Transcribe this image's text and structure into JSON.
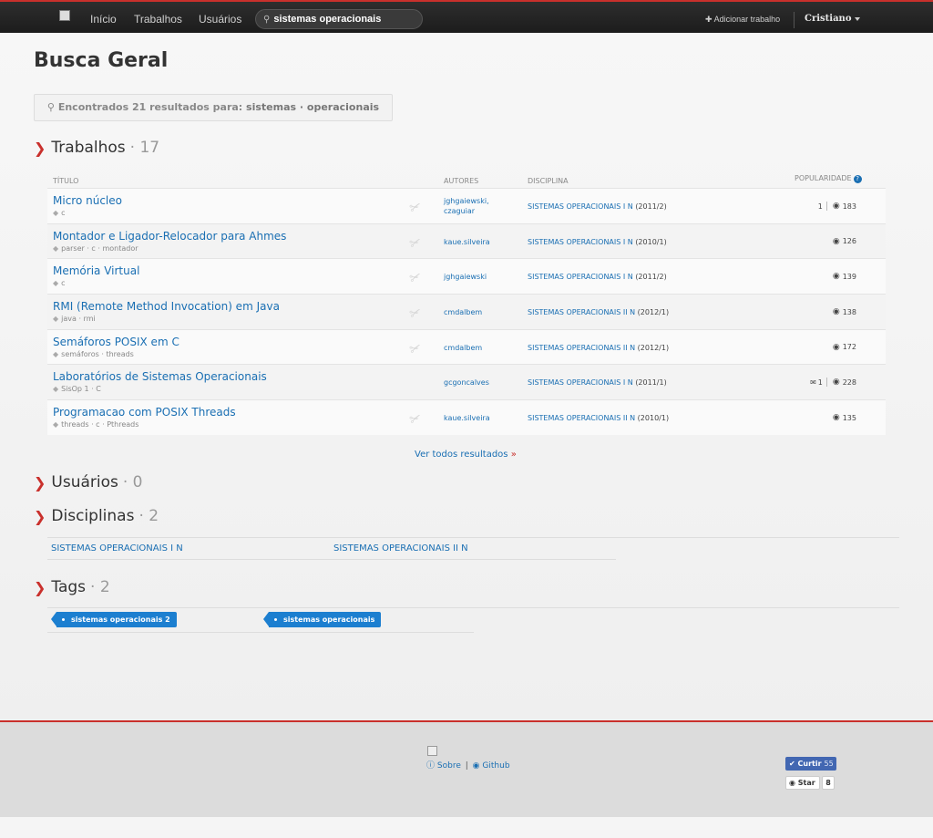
{
  "nav": {
    "links": [
      "Início",
      "Trabalhos",
      "Usuários"
    ],
    "search_value": "sistemas operacionais",
    "add_work": "Adicionar trabalho",
    "user": "Cristiano"
  },
  "page": {
    "title": "Busca Geral",
    "found_prefix": "Encontrados 21 resultados para:",
    "found_query": "sistemas · operacionais"
  },
  "works": {
    "title": "Trabalhos",
    "count": "· 17",
    "headers": {
      "title": "TÍTULO",
      "authors": "AUTORES",
      "discipline": "DISCIPLINA",
      "popularity": "POPULARIDADE"
    },
    "rows": [
      {
        "title": "Micro núcleo",
        "tags": "c",
        "authors": [
          "jghgaiewski,",
          "czaguiar"
        ],
        "discipline": "SISTEMAS OPERACIONAIS I N",
        "semester": "(2011/2)",
        "comments": "1",
        "views": "183",
        "clip": true
      },
      {
        "title": "Montador e Ligador-Relocador para Ahmes",
        "tags": "parser · c · montador",
        "authors": [
          "kaue.silveira"
        ],
        "discipline": "SISTEMAS OPERACIONAIS I N",
        "semester": "(2010/1)",
        "comments": "",
        "views": "126",
        "clip": true
      },
      {
        "title": "Memória Virtual",
        "tags": "c",
        "authors": [
          "jghgaiewski"
        ],
        "discipline": "SISTEMAS OPERACIONAIS I N",
        "semester": "(2011/2)",
        "comments": "",
        "views": "139",
        "clip": true
      },
      {
        "title": "RMI (Remote Method Invocation) em Java",
        "tags": "java · rmi",
        "authors": [
          "cmdalbem"
        ],
        "discipline": "SISTEMAS OPERACIONAIS II N",
        "semester": "(2012/1)",
        "comments": "",
        "views": "138",
        "clip": true
      },
      {
        "title": "Semáforos POSIX em C",
        "tags": "semáforos · threads",
        "authors": [
          "cmdalbem"
        ],
        "discipline": "SISTEMAS OPERACIONAIS II N",
        "semester": "(2012/1)",
        "comments": "",
        "views": "172",
        "clip": true
      },
      {
        "title": "Laboratórios de Sistemas Operacionais",
        "tags": "SisOp 1 · C",
        "authors": [
          "gcgoncalves"
        ],
        "discipline": "SISTEMAS OPERACIONAIS I N",
        "semester": "(2011/1)",
        "chat": "1",
        "views": "228",
        "clip": false
      },
      {
        "title": "Programacao com POSIX Threads",
        "tags": "threads · c · Pthreads",
        "authors": [
          "kaue.silveira"
        ],
        "discipline": "SISTEMAS OPERACIONAIS II N",
        "semester": "(2010/1)",
        "comments": "",
        "views": "135",
        "clip": true
      }
    ],
    "see_all": "Ver todos resultados"
  },
  "users": {
    "title": "Usuários",
    "count": "· 0"
  },
  "disciplines": {
    "title": "Disciplinas",
    "count": "· 2",
    "items": [
      "SISTEMAS OPERACIONAIS I N",
      "SISTEMAS OPERACIONAIS II N"
    ]
  },
  "tags": {
    "title": "Tags",
    "count": "· 2",
    "items": [
      "sistemas operacionais 2",
      "sistemas operacionais"
    ]
  },
  "footer": {
    "about": "Sobre",
    "sep": "|",
    "github": "Github",
    "like_label": "Curtir",
    "like_count": "55",
    "star_label": "Star",
    "star_count": "8"
  },
  "colors": {
    "accent": "#c9302c",
    "link": "#1a6fb3",
    "tag": "#1c7fd0"
  }
}
